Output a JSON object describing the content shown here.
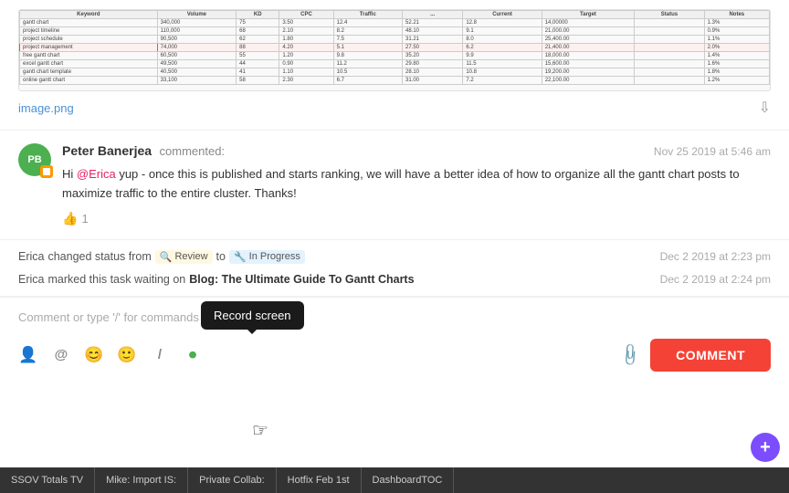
{
  "image": {
    "filename": "image.png",
    "download_tooltip": "Download"
  },
  "comment": {
    "avatar_initials": "PB",
    "avatar_badge_icon": "📦",
    "commenter_name": "Peter Banerjea",
    "comment_action": "commented:",
    "timestamp": "Nov 25 2019 at 5:46 am",
    "mention": "@Erica",
    "text_before_mention": "Hi ",
    "text_after_mention": " yup - once this is published and starts ranking, we will have a better idea of how to organize all the gantt chart posts to maximize traffic to the entire cluster. Thanks!",
    "like_count": "1"
  },
  "activity": [
    {
      "actor": "Erica",
      "action": "changed status from",
      "from_badge": "Review",
      "from_emoji": "🔍",
      "to_word": "to",
      "to_badge": "In Progress",
      "to_emoji": "🔧",
      "timestamp": "Dec 2 2019 at 2:23 pm"
    },
    {
      "actor": "Erica",
      "action": "marked this task waiting on",
      "link_text": "Blog: The Ultimate Guide To Gantt Charts",
      "timestamp": "Dec 2 2019 at 2:24 pm"
    }
  ],
  "comment_input": {
    "placeholder": "Comment or type '/' for commands",
    "button_label": "COMMENT"
  },
  "toolbar": {
    "icons": [
      {
        "name": "person-icon",
        "symbol": "👤"
      },
      {
        "name": "at-icon",
        "symbol": "@"
      },
      {
        "name": "emoji-face-icon",
        "symbol": "😊"
      },
      {
        "name": "smiley-icon",
        "symbol": "😄"
      },
      {
        "name": "slash-icon",
        "symbol": "/"
      },
      {
        "name": "record-icon",
        "symbol": "⏺",
        "active": true
      }
    ],
    "attachment_icon": "📎",
    "record_tooltip": "Record screen"
  },
  "taskbar": {
    "items": [
      "SSOV Totals TV",
      "Mike: Import IS:",
      "Private Collab:",
      "Hotfix Feb 1st",
      "DashboardTOC"
    ]
  },
  "floating": {
    "label": "+"
  }
}
